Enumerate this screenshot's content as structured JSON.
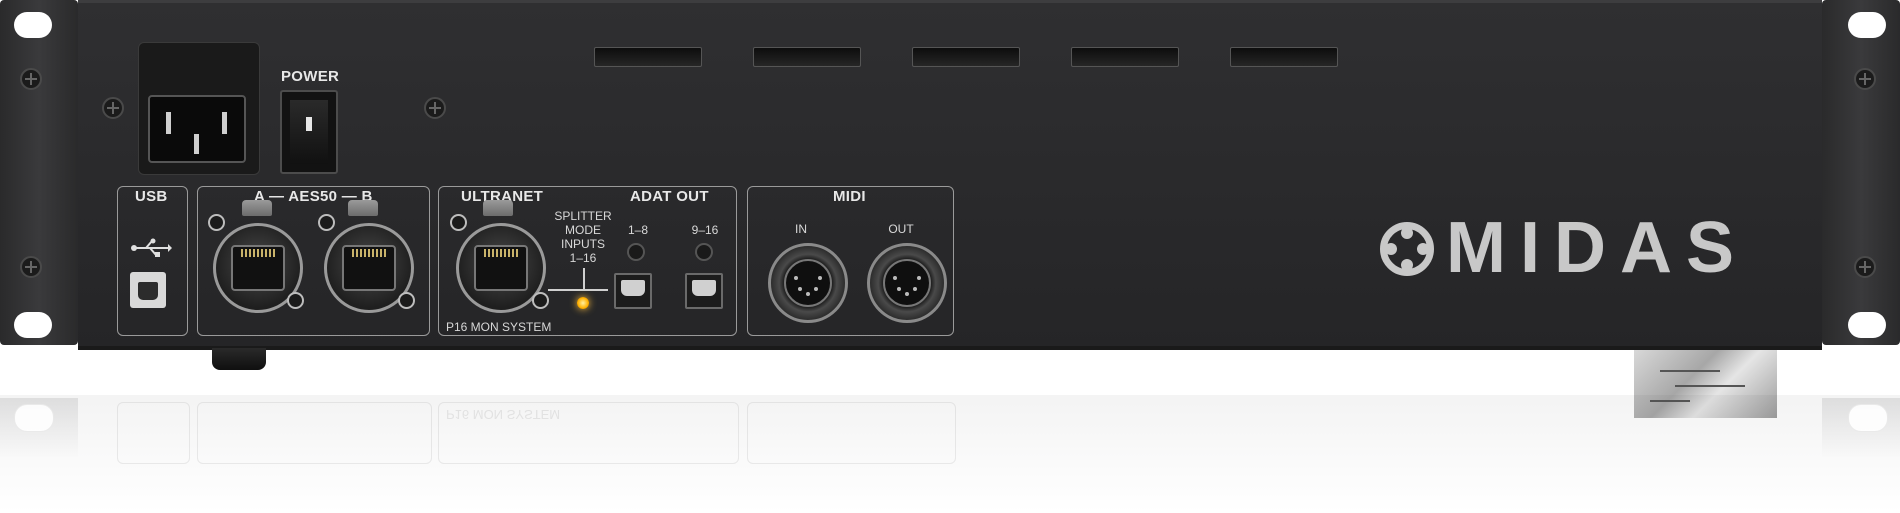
{
  "device": {
    "brand": "MIDAS"
  },
  "labels": {
    "power": "POWER",
    "usb": "USB",
    "aes50": "A — AES50 — B",
    "ultranet": "ULTRANET",
    "adat_out": "ADAT OUT",
    "splitter": "SPLITTER\nMODE\nINPUTS\n1–16",
    "adat_1_8": "1–8",
    "adat_9_16": "9–16",
    "p16": "P16 MON SYSTEM",
    "midi": "MIDI",
    "midi_in": "IN",
    "midi_out": "OUT",
    "usb_symbol": "⭠"
  },
  "reflection": {
    "p16_mirrored": "P16 MON SYSTEM"
  },
  "colors": {
    "chassis": "#2b2b2d",
    "panel_line": "#9a9a9a",
    "label": "#e8e8e8",
    "led": "#ffb000",
    "logo": "#c8c8c8"
  },
  "icons": [
    "screw-icon",
    "usb-icon",
    "led-indicator"
  ]
}
